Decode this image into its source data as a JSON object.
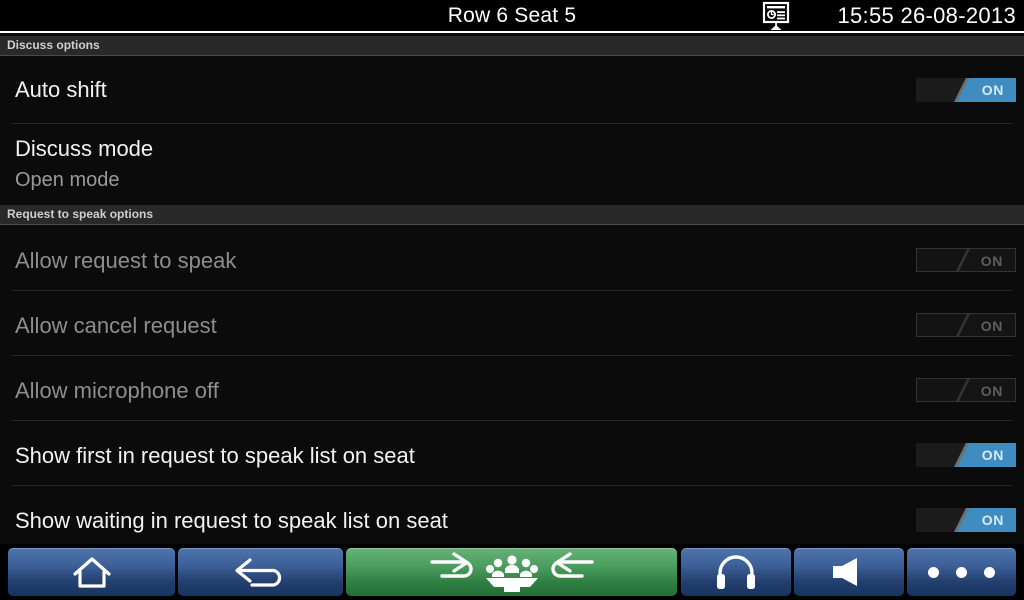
{
  "titlebar": {
    "title": "Row 6 Seat 5",
    "clock": "15:55 26-08-2013",
    "doc_icon": "presentation-screen-icon"
  },
  "sections": [
    {
      "header": "Discuss options"
    },
    {
      "header": "Request to speak options"
    }
  ],
  "rows": [
    {
      "label": "Auto shift",
      "sublabel": "",
      "toggle_label": "ON",
      "toggle_state": "on",
      "enabled": true
    },
    {
      "label": "Discuss mode",
      "sublabel": "Open mode",
      "toggle_label": "",
      "toggle_state": "none",
      "enabled": true
    },
    {
      "label": "Allow request to speak",
      "sublabel": "",
      "toggle_label": "ON",
      "toggle_state": "disabled",
      "enabled": false
    },
    {
      "label": "Allow cancel request",
      "sublabel": "",
      "toggle_label": "ON",
      "toggle_state": "disabled",
      "enabled": false
    },
    {
      "label": "Allow microphone off",
      "sublabel": "",
      "toggle_label": "ON",
      "toggle_state": "disabled",
      "enabled": false
    },
    {
      "label": "Show first in request to speak list on seat",
      "sublabel": "",
      "toggle_label": "ON",
      "toggle_state": "on",
      "enabled": true
    },
    {
      "label": "Show waiting in request to speak list on seat",
      "sublabel": "",
      "toggle_label": "ON",
      "toggle_state": "on",
      "enabled": true
    }
  ],
  "navbar": {
    "buttons": [
      {
        "icon": "home-icon",
        "color": "blue"
      },
      {
        "icon": "back-arrow-icon",
        "color": "blue"
      },
      {
        "icon": "discuss-group-icon",
        "color": "green"
      },
      {
        "icon": "headphones-icon",
        "color": "blue"
      },
      {
        "icon": "speaker-volume-icon",
        "color": "blue"
      },
      {
        "icon": "more-options-icon",
        "color": "blue"
      }
    ]
  },
  "colors": {
    "accent_blue": "#3f8dc0",
    "nav_blue": "#3b5f96",
    "nav_green": "#4a9c5c",
    "background": "#0a0a0a",
    "section_header_bg": "#292929",
    "text_primary": "#f2f2f2",
    "text_dim": "#8d8d8d"
  }
}
